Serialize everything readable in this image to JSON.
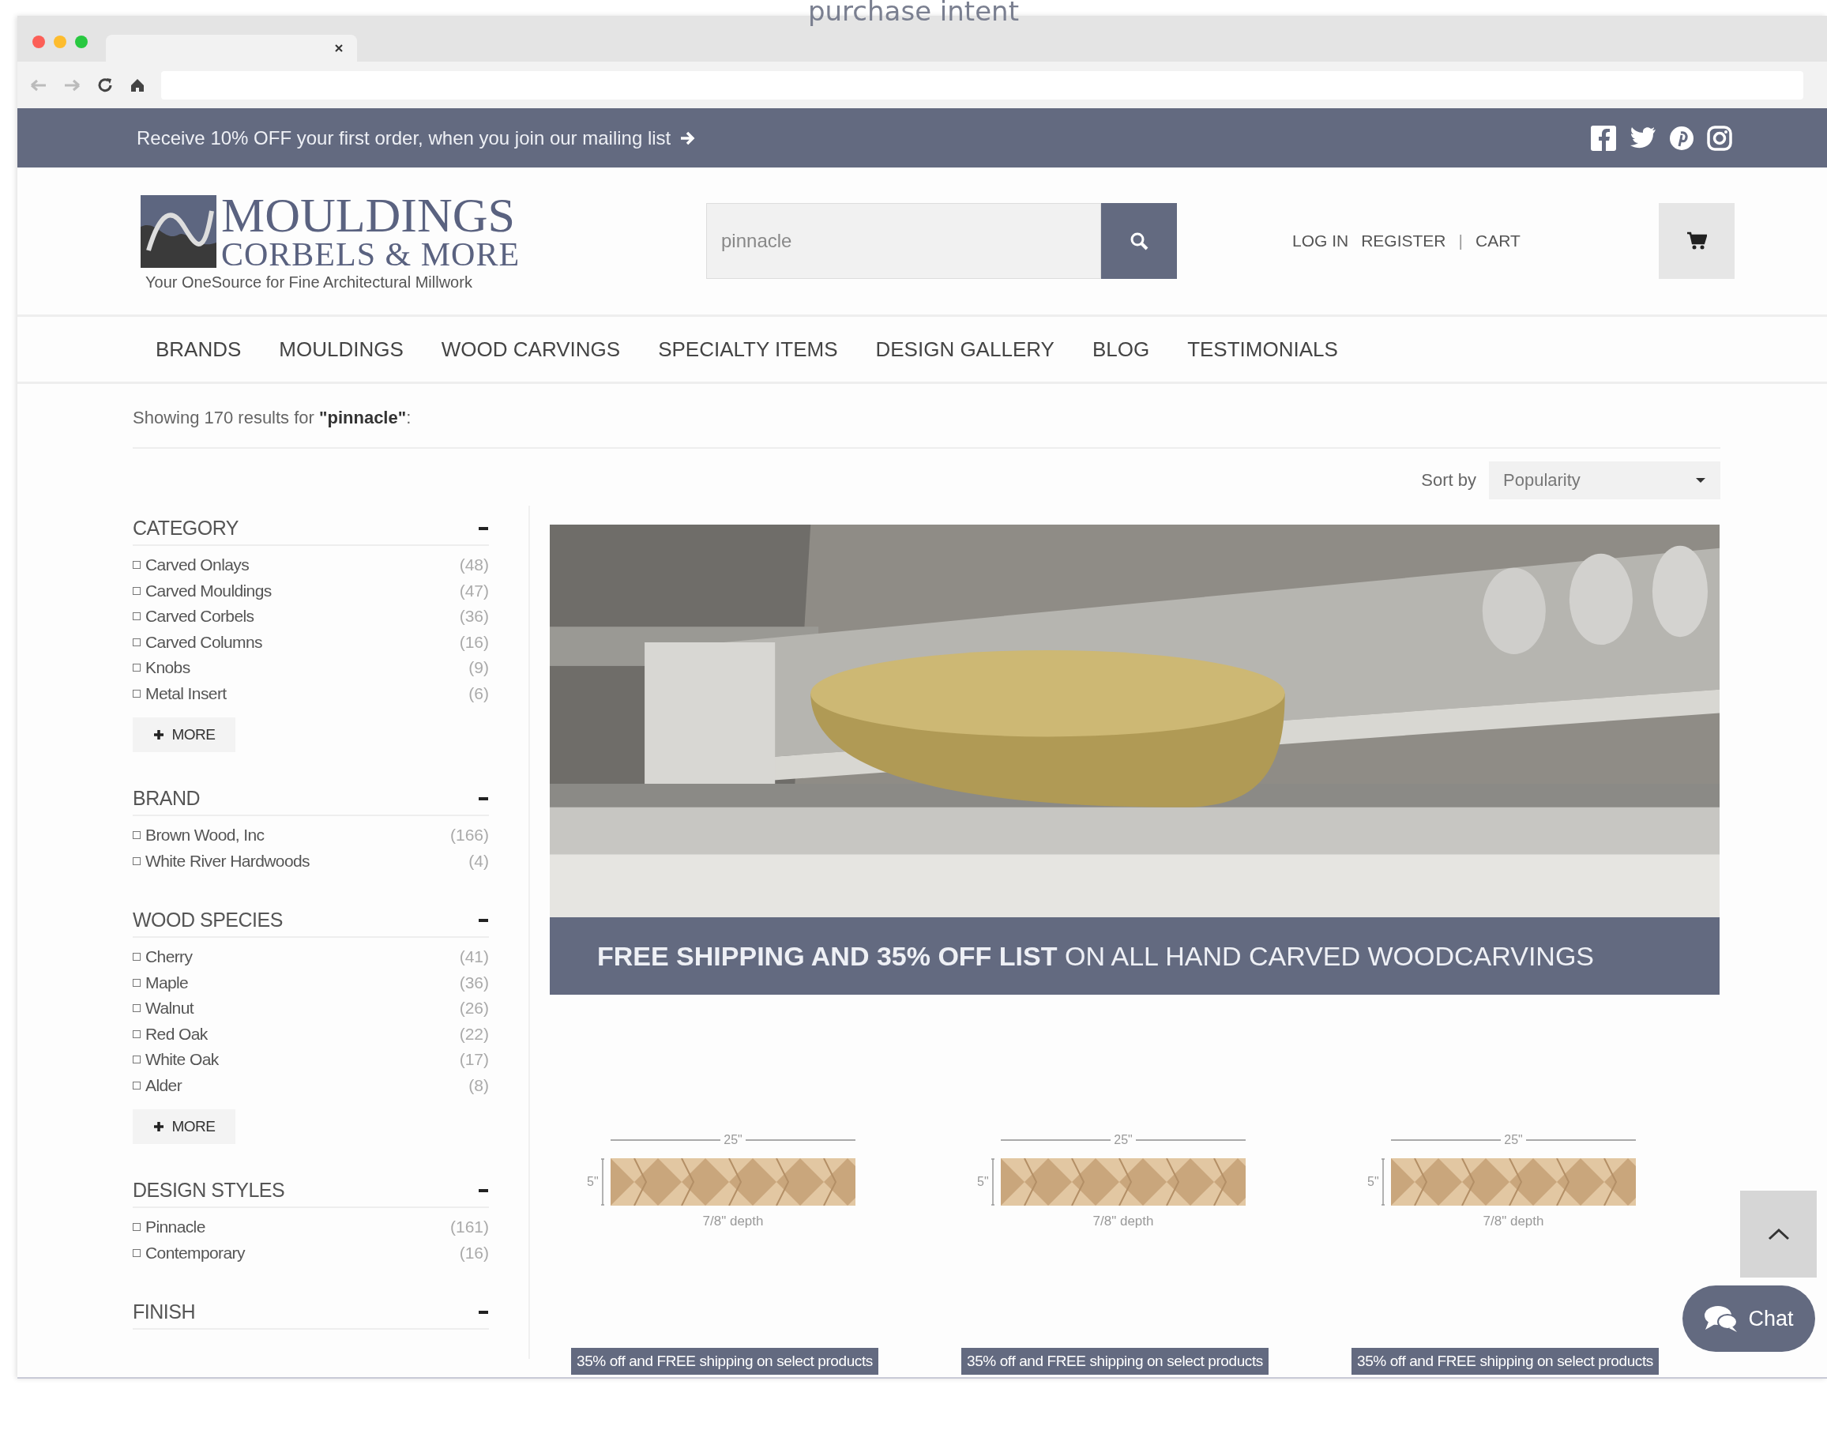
{
  "caption": "purchase intent",
  "promo_bar": {
    "text": "Receive 10% OFF your first order, when you join our mailing list"
  },
  "header": {
    "logo": {
      "title": "MOULDINGS",
      "subtitle": "CORBELS & MORE",
      "tagline": "Your OneSource for Fine Architectural Millwork"
    },
    "search": {
      "value": "pinnacle"
    },
    "links": [
      {
        "kind": "link",
        "label": "LOG IN"
      },
      {
        "kind": "link",
        "label": "REGISTER"
      },
      {
        "kind": "separator",
        "label": "|"
      },
      {
        "kind": "link",
        "label": "CART"
      }
    ]
  },
  "nav": [
    {
      "label": "BRANDS"
    },
    {
      "label": "MOULDINGS"
    },
    {
      "label": "WOOD CARVINGS"
    },
    {
      "label": "SPECIALTY ITEMS"
    },
    {
      "label": "DESIGN GALLERY"
    },
    {
      "label": "BLOG"
    },
    {
      "label": "TESTIMONIALS"
    }
  ],
  "results": {
    "text": "Showing 170 results for **\"pinnacle\"**:"
  },
  "sort": {
    "label": "Sort by",
    "value": "Popularity"
  },
  "sidebar": {
    "sections": [
      {
        "title": "CATEGORY",
        "expanded": true,
        "more": "MORE",
        "items": [
          {
            "label": "Carved Onlays",
            "count": "(48)",
            "checked": false
          },
          {
            "label": "Carved Mouldings",
            "count": "(47)",
            "checked": false
          },
          {
            "label": "Carved Corbels",
            "count": "(36)",
            "checked": false
          },
          {
            "label": "Carved Columns",
            "count": "(16)",
            "checked": false
          },
          {
            "label": "Knobs",
            "count": "(9)",
            "checked": false
          },
          {
            "label": "Metal Insert",
            "count": "(6)",
            "checked": false
          }
        ]
      },
      {
        "title": "BRAND",
        "expanded": true,
        "items": [
          {
            "label": "Brown Wood, Inc",
            "count": "(166)",
            "checked": false
          },
          {
            "label": "White River Hardwoods",
            "count": "(4)",
            "checked": false
          }
        ]
      },
      {
        "title": "WOOD SPECIES",
        "expanded": true,
        "more": "MORE",
        "items": [
          {
            "label": "Cherry",
            "count": "(41)",
            "checked": false
          },
          {
            "label": "Maple",
            "count": "(36)",
            "checked": false
          },
          {
            "label": "Walnut",
            "count": "(26)",
            "checked": false
          },
          {
            "label": "Red Oak",
            "count": "(22)",
            "checked": false
          },
          {
            "label": "White Oak",
            "count": "(17)",
            "checked": false
          },
          {
            "label": "Alder",
            "count": "(8)",
            "checked": false
          }
        ]
      },
      {
        "title": "DESIGN STYLES",
        "expanded": true,
        "items": [
          {
            "label": "Pinnacle",
            "count": "(161)",
            "checked": false
          },
          {
            "label": "Contemporary",
            "count": "(16)",
            "checked": false
          }
        ]
      },
      {
        "title": "FINISH",
        "expanded": true
      }
    ]
  },
  "banner": {
    "kind": "picture",
    "caption": "**FREE SHIPPING AND 35% OFF LIST** ON ALL HAND CARVED WOODCARVINGS"
  },
  "products": [
    {
      "width_label": "25\"",
      "height_label": "5\"",
      "depth_label": "7/8\" depth",
      "badge": "35% off and FREE shipping on select products"
    },
    {
      "width_label": "25\"",
      "height_label": "5\"",
      "depth_label": "7/8\" depth",
      "badge": "35% off and FREE shipping on select products"
    },
    {
      "width_label": "25\"",
      "height_label": "5\"",
      "depth_label": "7/8\" depth",
      "badge": "35% off and FREE shipping on select products"
    }
  ],
  "chat": {
    "label": "Chat"
  }
}
